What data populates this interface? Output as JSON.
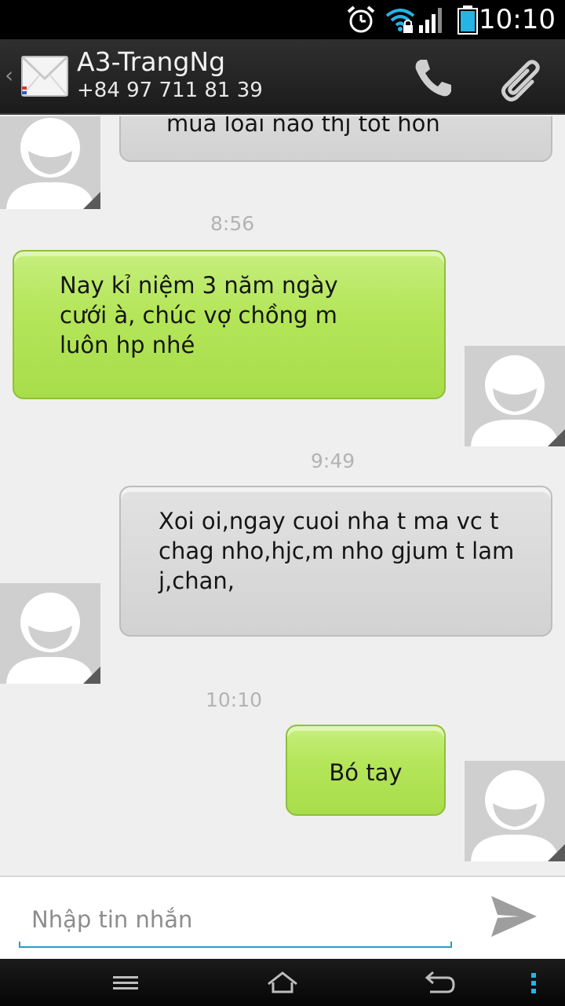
{
  "status_bar": {
    "time": "10:10",
    "icons": [
      "alarm-icon",
      "wifi-icon",
      "signal-icon",
      "battery-icon"
    ],
    "battery_color": "#26b4e6"
  },
  "header": {
    "contact_name": "A3-TrangNg",
    "contact_number": "+84 97 711 81 39",
    "icons": [
      "envelope-icon",
      "phone-icon",
      "paperclip-icon"
    ]
  },
  "conversation": {
    "messages": [
      {
        "type": "received",
        "text": "mua loai nao thj tot hon"
      },
      {
        "type": "timestamp",
        "text": "8:56"
      },
      {
        "type": "sent",
        "text": "Nay kỉ niệm 3 năm ngày cưới à, chúc vợ chồng m luôn hp nhé"
      },
      {
        "type": "timestamp",
        "text": "9:49"
      },
      {
        "type": "received",
        "text": "Xoi oi,ngay cuoi nha t ma vc t chag nho,hjc,m nho gjum t lam j,chan,"
      },
      {
        "type": "timestamp",
        "text": "10:10"
      },
      {
        "type": "sent",
        "text": "Bó tay"
      }
    ]
  },
  "composer": {
    "placeholder": "Nhập tin nhắn",
    "value": "",
    "accent_color": "#2a9bc4"
  },
  "colors": {
    "sent_bubble": "#b5e65b",
    "received_bubble": "#d8d8d8",
    "background": "#efefef"
  },
  "nav_bar": {
    "icons": [
      "menu-icon",
      "home-icon",
      "back-icon",
      "overflow-icon"
    ]
  }
}
